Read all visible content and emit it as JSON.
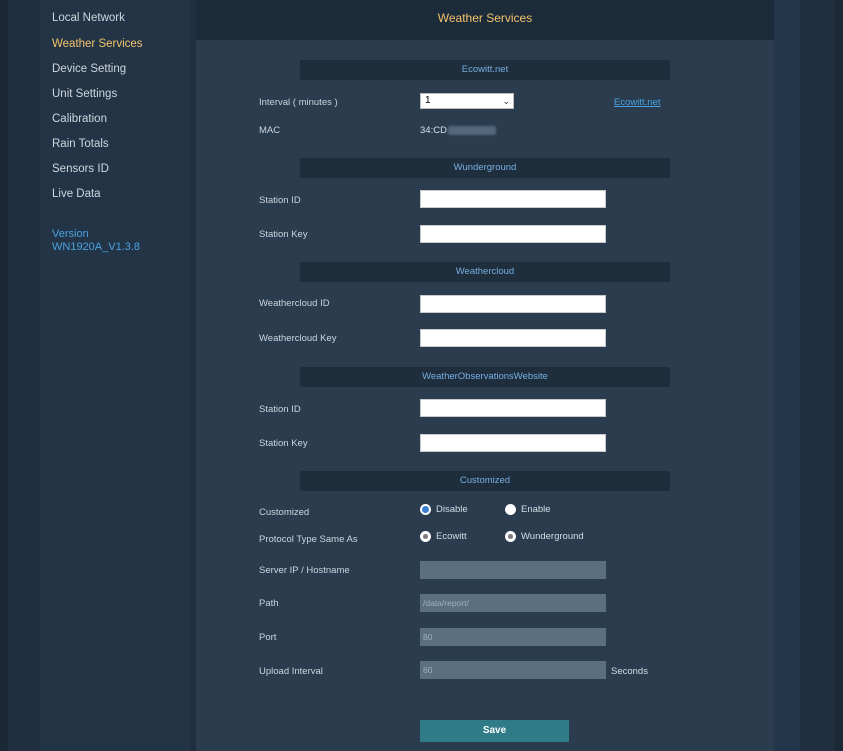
{
  "sidebar": {
    "items": [
      {
        "label": "Local Network",
        "active": false
      },
      {
        "label": "Weather Services",
        "active": true
      },
      {
        "label": "Device Setting",
        "active": false
      },
      {
        "label": "Unit Settings",
        "active": false
      },
      {
        "label": "Calibration",
        "active": false
      },
      {
        "label": "Rain Totals",
        "active": false
      },
      {
        "label": "Sensors ID",
        "active": false
      },
      {
        "label": "Live Data",
        "active": false
      }
    ],
    "version_label": "Version",
    "version_value": "WN1920A_V1.3.8"
  },
  "page_title": "Weather Services",
  "ecowitt": {
    "header": "Ecowitt.net",
    "interval_label": "Interval ( minutes )",
    "interval_value": "1",
    "link_text": "Ecowitt.net",
    "mac_label": "MAC",
    "mac_value": "34:CD"
  },
  "wunderground": {
    "header": "Wunderground",
    "station_id_label": "Station ID",
    "station_key_label": "Station Key"
  },
  "weathercloud": {
    "header": "Weathercloud",
    "id_label": "Weathercloud ID",
    "key_label": "Weathercloud Key"
  },
  "wow": {
    "header": "WeatherObservationsWebsite",
    "station_id_label": "Station ID",
    "station_key_label": "Station Key"
  },
  "customized": {
    "header": "Customized",
    "customized_label": "Customized",
    "disable_label": "Disable",
    "enable_label": "Enable",
    "protocol_label": "Protocol Type Same As",
    "ecowitt_label": "Ecowitt",
    "wunderground_label": "Wunderground",
    "server_label": "Server IP / Hostname",
    "server_value": "",
    "path_label": "Path",
    "path_value": "/data/report/",
    "port_label": "Port",
    "port_value": "80",
    "upload_label": "Upload Interval",
    "upload_value": "60",
    "seconds_label": "Seconds"
  },
  "save_label": "Save",
  "colors": {
    "accent": "#f3c36b",
    "link": "#4aa3e0",
    "save": "#2f7b88"
  }
}
